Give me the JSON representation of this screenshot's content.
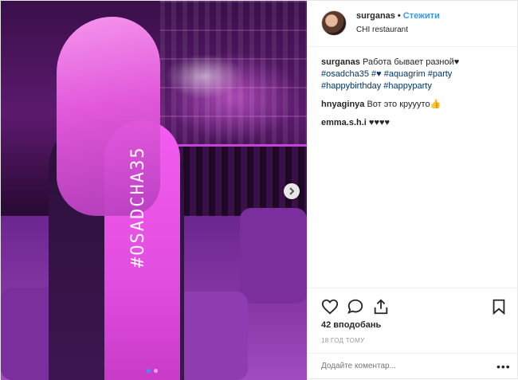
{
  "header": {
    "username": "surganas",
    "separator": "•",
    "follow_label": "Стежити",
    "location": "CHI restaurant"
  },
  "photo": {
    "tattoo_text": "#OSADCHA35",
    "next_icon": "chevron-right-icon",
    "carousel_dots": 2,
    "active_dot": 1
  },
  "comments": [
    {
      "user": "surganas",
      "text": "Работа бывает разной♥"
    },
    {
      "user": "hnyaginya",
      "text": "Вот это круууто👍"
    },
    {
      "user": "emma.s.h.i",
      "text": "♥♥♥♥"
    }
  ],
  "caption_tags": [
    "#osadcha35 #♥ #aquagrim #party",
    "#happybirthday #happyparty"
  ],
  "actions": {
    "like_icon": "heart-icon",
    "comment_icon": "comment-icon",
    "share_icon": "share-icon",
    "save_icon": "bookmark-icon"
  },
  "likes_text": "42 вподобань",
  "timestamp": "18 ГОД ТОМУ",
  "add_comment": {
    "placeholder": "Додайте коментар...",
    "more_label": "•••"
  },
  "colors": {
    "link": "#3897f0",
    "hashtag": "#003569",
    "text": "#262626",
    "muted": "#999999"
  }
}
